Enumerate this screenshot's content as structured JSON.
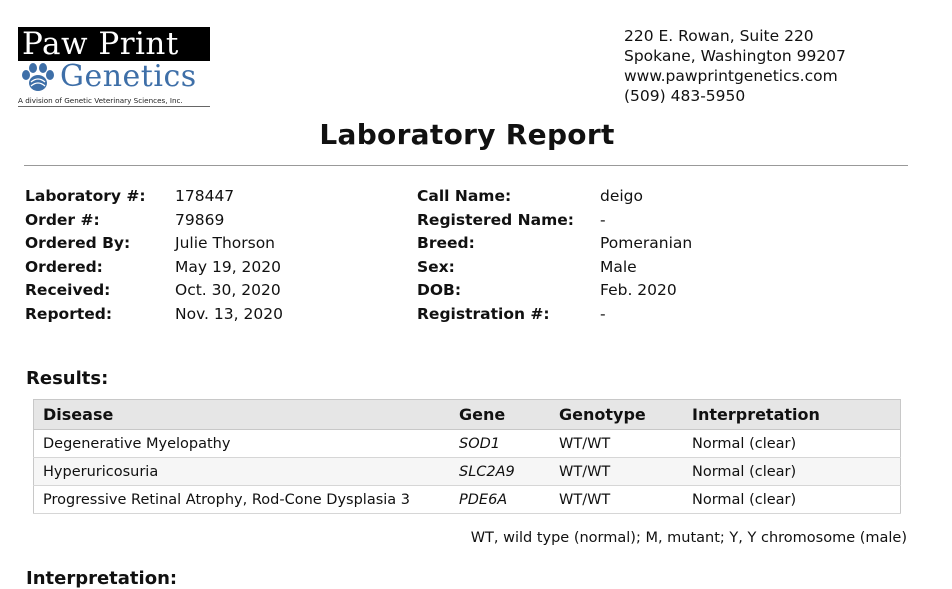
{
  "logo": {
    "line1": "Paw Print",
    "line2": "Genetics",
    "tagline": "A division of Genetic Veterinary Sciences, Inc."
  },
  "address": {
    "line1": "220 E. Rowan, Suite 220",
    "line2": "Spokane, Washington 99207",
    "website": "www.pawprintgenetics.com",
    "phone": "(509) 483-5950"
  },
  "title": "Laboratory Report",
  "order_info": [
    {
      "label": "Laboratory #:",
      "value": "178447"
    },
    {
      "label": "Order #:",
      "value": "79869"
    },
    {
      "label": "Ordered By:",
      "value": "Julie Thorson"
    },
    {
      "label": "Ordered:",
      "value": "May 19, 2020"
    },
    {
      "label": "Received:",
      "value": "Oct. 30, 2020"
    },
    {
      "label": "Reported:",
      "value": "Nov. 13, 2020"
    }
  ],
  "dog_info": [
    {
      "label": "Call Name:",
      "value": "deigo"
    },
    {
      "label": "Registered Name:",
      "value": "-"
    },
    {
      "label": "Breed:",
      "value": "Pomeranian"
    },
    {
      "label": "Sex:",
      "value": "Male"
    },
    {
      "label": "DOB:",
      "value": "Feb. 2020"
    },
    {
      "label": "Registration #:",
      "value": "-"
    }
  ],
  "results": {
    "heading": "Results:",
    "columns": [
      "Disease",
      "Gene",
      "Genotype",
      "Interpretation"
    ],
    "rows": [
      {
        "disease": "Degenerative Myelopathy",
        "gene": "SOD1",
        "genotype": "WT/WT",
        "interpretation": "Normal (clear)"
      },
      {
        "disease": "Hyperuricosuria",
        "gene": "SLC2A9",
        "genotype": "WT/WT",
        "interpretation": "Normal (clear)"
      },
      {
        "disease": "Progressive Retinal Atrophy, Rod-Cone Dysplasia 3",
        "gene": "PDE6A",
        "genotype": "WT/WT",
        "interpretation": "Normal (clear)"
      }
    ],
    "footnote": "WT, wild type (normal); M, mutant; Y, Y chromosome (male)"
  },
  "interpretation_heading": "Interpretation:",
  "colors": {
    "logo_blue": "#3e6fa8",
    "header_bg": "#e6e6e6"
  }
}
